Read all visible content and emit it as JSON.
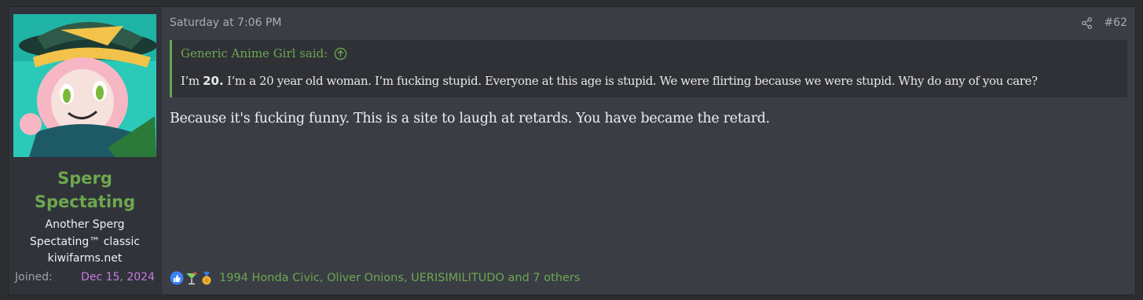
{
  "user": {
    "name": "Sperg Spectating",
    "title": "Another Sperg Spectating™ classic",
    "site": "kiwifarms.net",
    "joined_label": "Joined:",
    "joined_date": "Dec 15, 2024"
  },
  "post": {
    "date": "Saturday at 7:06 PM",
    "number": "#62",
    "quote": {
      "author_line": "Generic Anime Girl said:",
      "prefix": "I’m ",
      "bold": "20.",
      "rest": " I’m a 20 year old woman. I’m fucking stupid. Everyone at this age is stupid. We were flirting because we were stupid. Why do any of you care?"
    },
    "message": "Because it's fucking funny. This is a site to laugh at retards. You have became the retard.",
    "reactions": {
      "icons": [
        "like-icon",
        "cocktail-icon",
        "medal-icon"
      ],
      "text": "1994 Honda Civic, Oliver Onions, UERISIMILITUDO and 7 others"
    }
  },
  "colors": {
    "accent_green": "#6da74f",
    "joined_date": "#c67be0",
    "background": "#3a3d44"
  }
}
